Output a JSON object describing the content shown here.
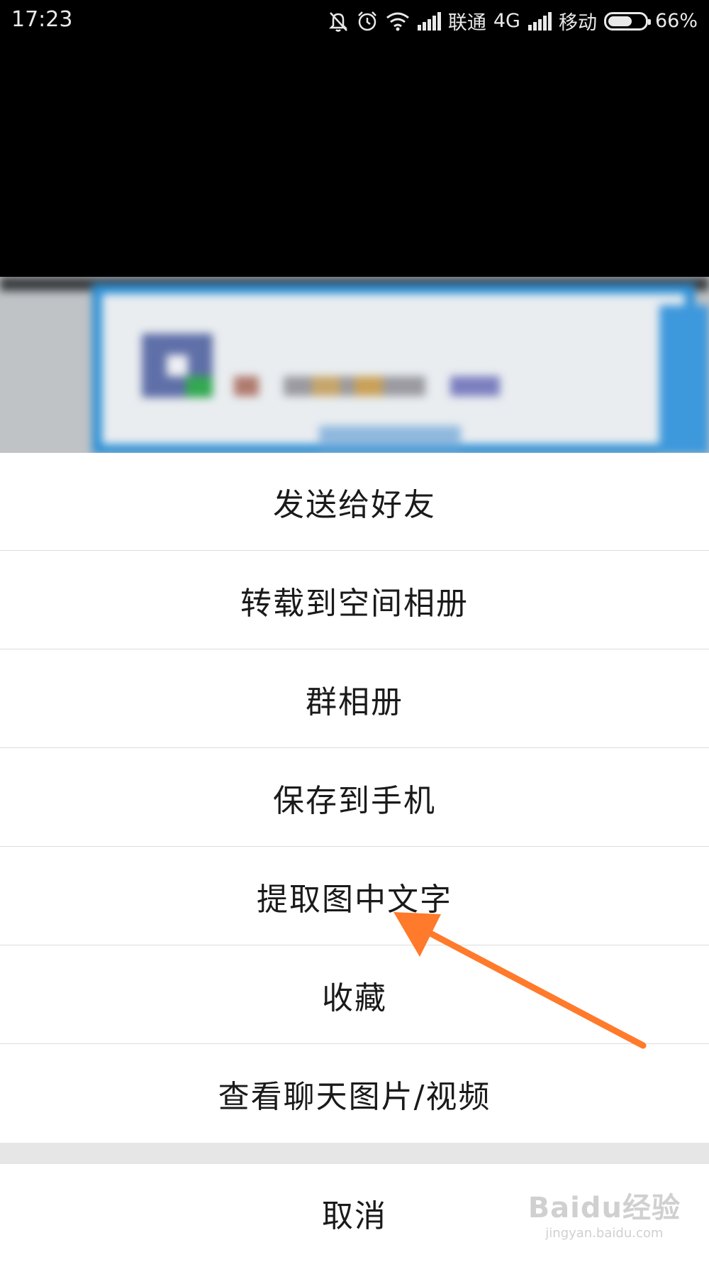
{
  "status_bar": {
    "time": "17:23",
    "carrier_1": "联通",
    "network_type": "4G",
    "carrier_2": "移动",
    "battery_percent": "66%",
    "battery_level": 0.66,
    "icons": [
      "mute-icon",
      "alarm-icon",
      "wifi-icon",
      "signal-icon",
      "signal-icon",
      "battery-icon"
    ]
  },
  "action_sheet": {
    "items": [
      {
        "label": "发送给好友"
      },
      {
        "label": "转载到空间相册"
      },
      {
        "label": "群相册"
      },
      {
        "label": "保存到手机"
      },
      {
        "label": "提取图中文字"
      },
      {
        "label": "收藏"
      },
      {
        "label": "查看聊天图片/视频"
      }
    ],
    "cancel_label": "取消"
  },
  "annotation": {
    "arrow_color": "#ff7a2a",
    "target_item": "提取图中文字"
  },
  "watermark": {
    "main": "Baidu经验",
    "sub": "jingyan.baidu.com"
  }
}
